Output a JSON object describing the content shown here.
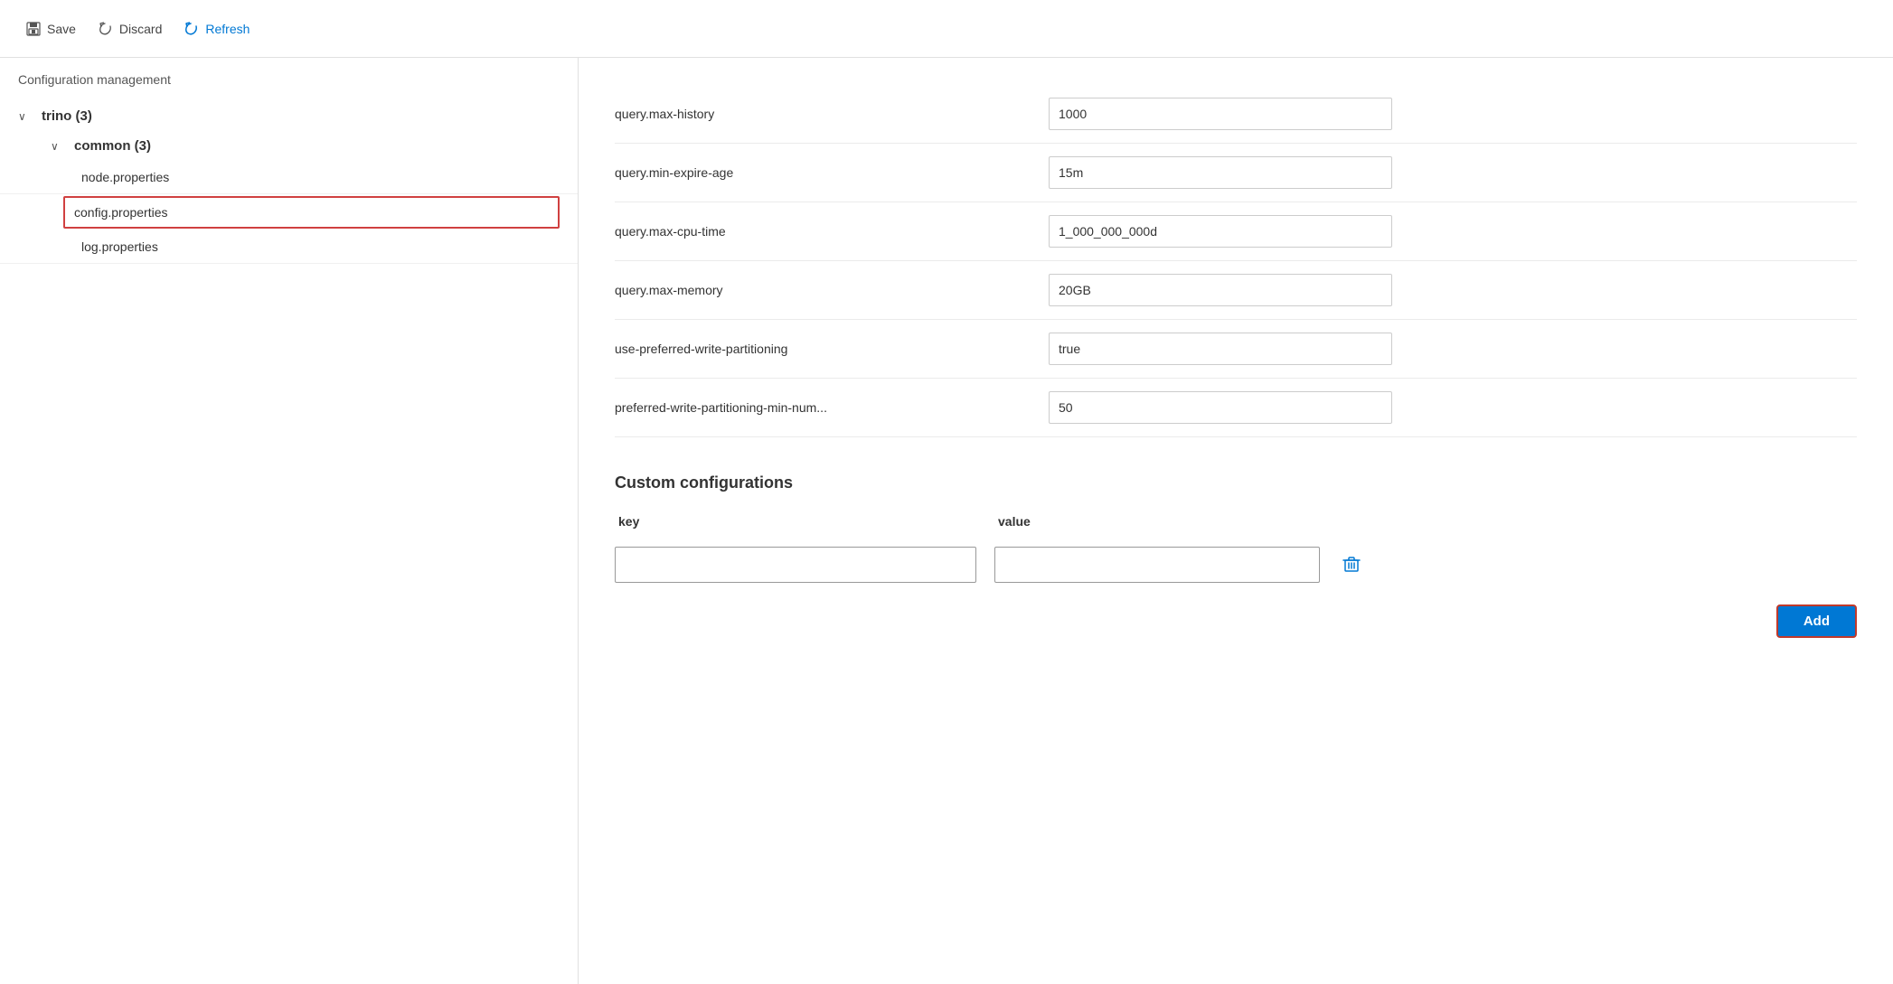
{
  "toolbar": {
    "save_label": "Save",
    "discard_label": "Discard",
    "refresh_label": "Refresh"
  },
  "sidebar": {
    "title": "Configuration management",
    "tree": {
      "root_label": "trino (3)",
      "root_expanded": true,
      "child_label": "common (3)",
      "child_expanded": true,
      "leaves": [
        {
          "id": "node-properties",
          "label": "node.properties",
          "selected": false
        },
        {
          "id": "config-properties",
          "label": "config.properties",
          "selected": true
        },
        {
          "id": "log-properties",
          "label": "log.properties",
          "selected": false
        }
      ]
    }
  },
  "config": {
    "rows": [
      {
        "key": "query.max-history",
        "value": "1000"
      },
      {
        "key": "query.min-expire-age",
        "value": "15m"
      },
      {
        "key": "query.max-cpu-time",
        "value": "1_000_000_000d"
      },
      {
        "key": "query.max-memory",
        "value": "20GB"
      },
      {
        "key": "use-preferred-write-partitioning",
        "value": "true"
      },
      {
        "key": "preferred-write-partitioning-min-num...",
        "value": "50"
      }
    ]
  },
  "custom_config": {
    "title": "Custom configurations",
    "key_header": "key",
    "value_header": "value",
    "add_label": "Add",
    "row": {
      "key_value": "",
      "value_value": ""
    }
  }
}
